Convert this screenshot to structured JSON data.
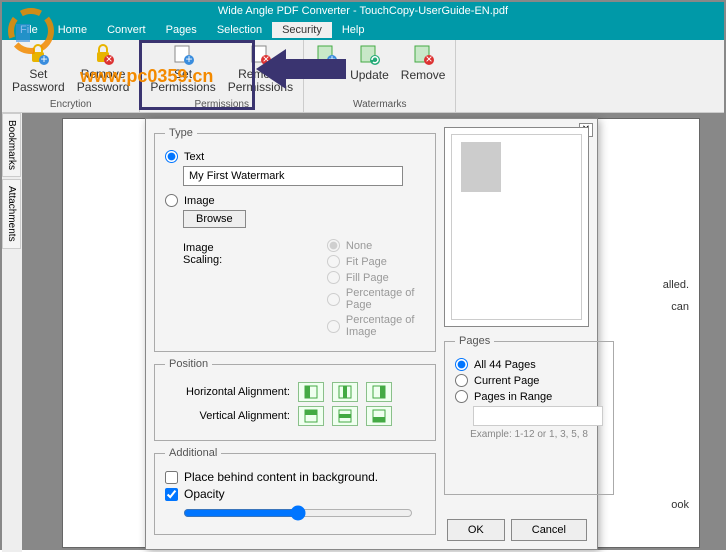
{
  "window": {
    "title": "Wide Angle PDF Converter - TouchCopy-UserGuide-EN.pdf"
  },
  "menu": {
    "file": "File",
    "home": "Home",
    "convert": "Convert",
    "pages": "Pages",
    "selection": "Selection",
    "security": "Security",
    "help": "Help"
  },
  "ribbon": {
    "pwd": {
      "set": "Set\nPassword",
      "remove": "Remove\nPassword",
      "group": "Encrytion"
    },
    "perm": {
      "set": "Set\nPermissions",
      "remove": "Remove\nPermissions",
      "group": "Permissions"
    },
    "wm": {
      "add": "Add",
      "update": "Update",
      "remove": "Remove",
      "group": "Watermarks"
    }
  },
  "sidebar": {
    "bookmarks": "Bookmarks",
    "attachments": "Attachments"
  },
  "doc": {
    "t1": "alled.",
    "t2": "can",
    "t3": "ook"
  },
  "dialog": {
    "type": {
      "legend": "Type",
      "text": "Text",
      "value": "My First Watermark",
      "image": "Image",
      "browse": "Browse",
      "scaling_label": "Image Scaling:",
      "none": "None",
      "fit_page": "Fit Page",
      "fill_page": "Fill Page",
      "pct_page": "Percentage of Page",
      "pct_image": "Percentage of Image"
    },
    "position": {
      "legend": "Position",
      "h": "Horizontal Alignment:",
      "v": "Vertical Alignment:"
    },
    "additional": {
      "legend": "Additional",
      "behind": "Place behind content in background.",
      "opacity": "Opacity"
    },
    "pages": {
      "legend": "Pages",
      "all": "All 44 Pages",
      "current": "Current Page",
      "range": "Pages in Range",
      "example": "Example: 1-12 or 1, 3, 5, 8"
    },
    "ok": "OK",
    "cancel": "Cancel"
  },
  "overlay": {
    "url": "www.pc0359.cn"
  }
}
